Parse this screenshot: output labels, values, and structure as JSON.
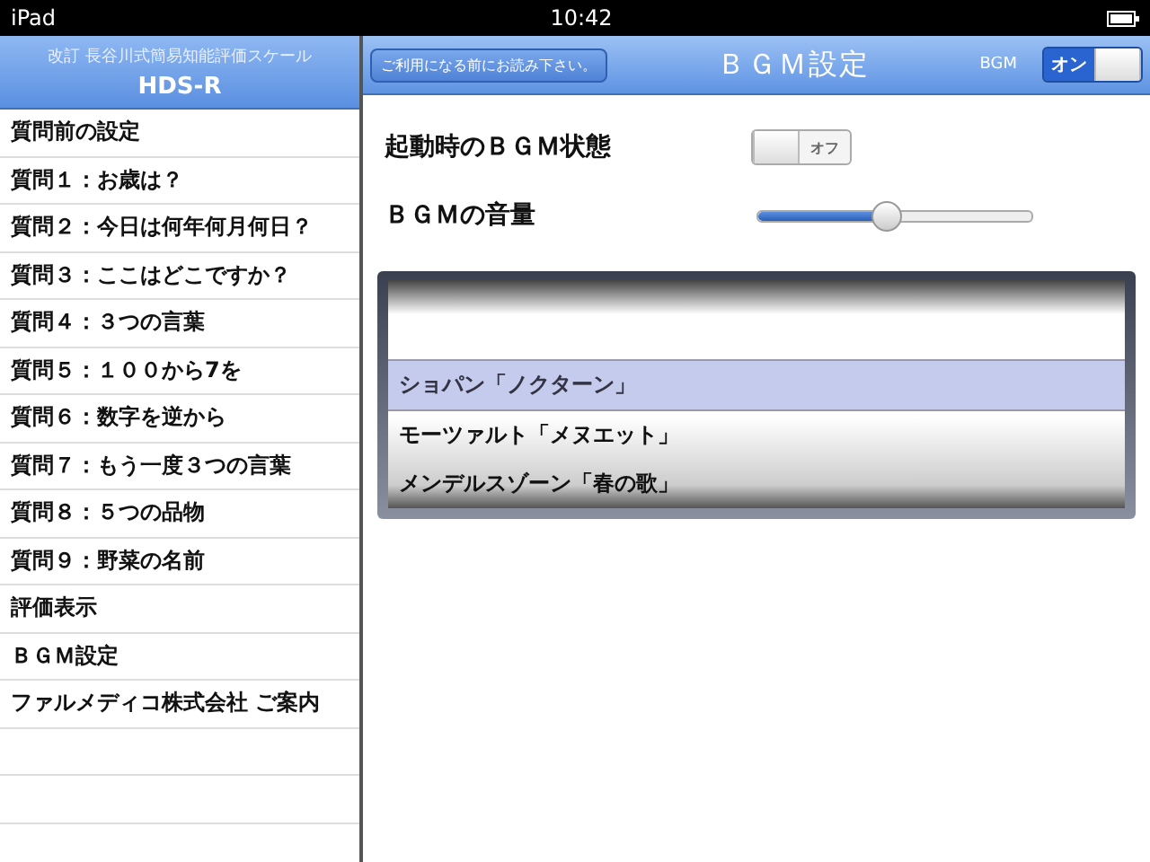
{
  "status_bar": {
    "device": "iPad",
    "time": "10:42"
  },
  "sidebar": {
    "subtitle": "改訂 長谷川式簡易知能評価スケール",
    "title": "HDS-R",
    "items": [
      {
        "label": "質問前の設定",
        "selected": false
      },
      {
        "label": "質問１：お歳は？",
        "selected": false
      },
      {
        "label": "質問２：今日は何年何月何日？",
        "selected": false
      },
      {
        "label": "質問３：ここはどこですか？",
        "selected": false
      },
      {
        "label": "質問４：３つの言葉",
        "selected": false
      },
      {
        "label": "質問５：１００から7を",
        "selected": false
      },
      {
        "label": "質問６：数字を逆から",
        "selected": false
      },
      {
        "label": "質問７：もう一度３つの言葉",
        "selected": false
      },
      {
        "label": "質問８：５つの品物",
        "selected": false
      },
      {
        "label": "質問９：野菜の名前",
        "selected": false
      },
      {
        "label": "評価表示",
        "selected": false
      },
      {
        "label": "ＢＧＭ設定",
        "selected": false
      },
      {
        "label": "ファルメディコ株式会社 ご案内",
        "selected": false
      }
    ]
  },
  "navbar": {
    "notice_button": "ご利用になる前にお読み下さい。",
    "title": "ＢＧＭ設定",
    "bgm_label": "BGM",
    "bgm_switch": {
      "on": true,
      "label": "オン"
    }
  },
  "settings": {
    "startup_label": "起動時のＢＧＭ状態",
    "startup_switch": {
      "on": false,
      "label": "オフ"
    },
    "volume_label": "ＢＧＭの音量",
    "volume": {
      "level": 0.47
    }
  },
  "picker": {
    "items": [
      {
        "label": "ショパン「ノクターン」",
        "selected": true
      },
      {
        "label": "モーツァルト「メヌエット」",
        "selected": false
      },
      {
        "label": "メンデルスゾーン「春の歌」",
        "selected": false
      }
    ]
  }
}
